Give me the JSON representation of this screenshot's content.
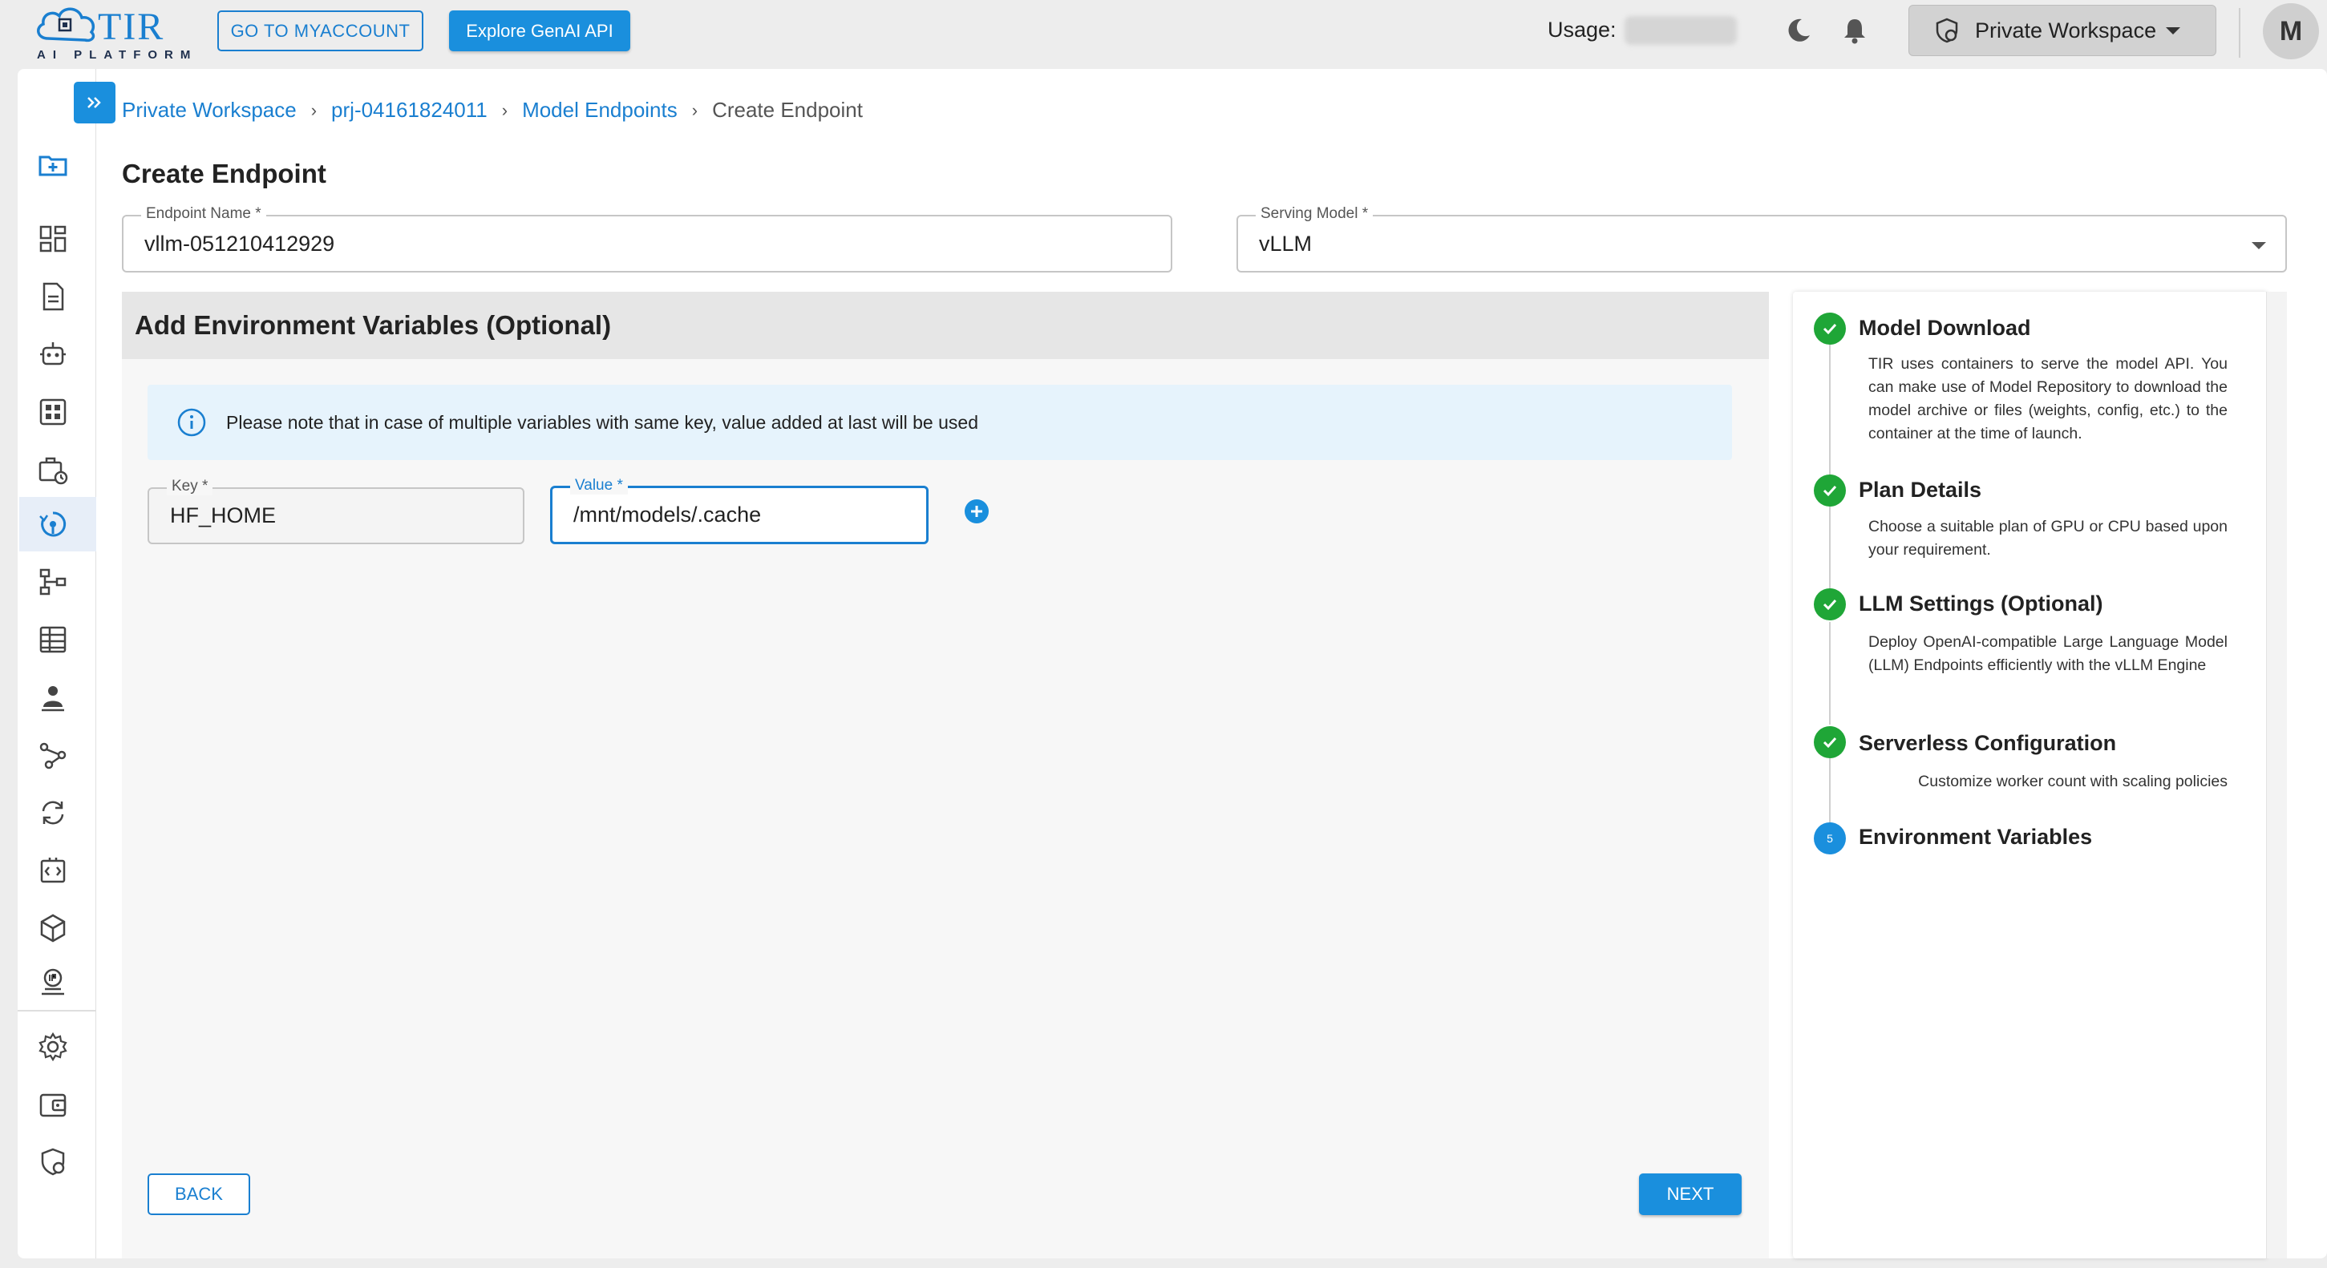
{
  "brand": {
    "name": "TIR",
    "tagline": "AI PLATFORM"
  },
  "topbar": {
    "myaccount_label": "GO TO MYACCOUNT",
    "genai_label": "Explore GenAI API",
    "usage_label": "Usage:",
    "workspace_label": "Private Workspace",
    "avatar_initial": "M"
  },
  "breadcrumb": {
    "items": [
      "Private Workspace",
      "prj-04161824011",
      "Model Endpoints"
    ],
    "current": "Create Endpoint",
    "separator": "›"
  },
  "page": {
    "title": "Create Endpoint"
  },
  "form": {
    "endpoint_name": {
      "label": "Endpoint Name *",
      "value": "vllm-051210412929"
    },
    "serving_model": {
      "label": "Serving Model *",
      "value": "vLLM"
    }
  },
  "env": {
    "title": "Add Environment Variables (Optional)",
    "info": "Please note that in case of multiple variables with same key, value added at last will be used",
    "key_label": "Key *",
    "key_value": "HF_HOME",
    "value_label": "Value *",
    "value_value": "/mnt/models/.cache"
  },
  "actions": {
    "back": "BACK",
    "next": "NEXT"
  },
  "steps": [
    {
      "title": "Model Download",
      "desc": "TIR uses containers to serve the model API. You can make use of Model Repository to download the model archive or files (weights, config, etc.) to the container at the time of launch.",
      "status": "done"
    },
    {
      "title": "Plan Details",
      "desc": "Choose a suitable plan of GPU or CPU based upon your requirement.",
      "status": "done"
    },
    {
      "title": "LLM Settings (Optional)",
      "desc": "Deploy OpenAI-compatible Large Language Model (LLM) Endpoints efficiently with the vLLM Engine",
      "status": "done"
    },
    {
      "title": "Serverless Configuration",
      "desc": "Customize worker count with scaling policies",
      "status": "done"
    },
    {
      "title": "Environment Variables",
      "desc": "",
      "status": "current",
      "number": "5"
    }
  ],
  "colors": {
    "accent": "#1a8fdd",
    "success": "#1fa637",
    "info_bg": "#e6f3fc"
  }
}
